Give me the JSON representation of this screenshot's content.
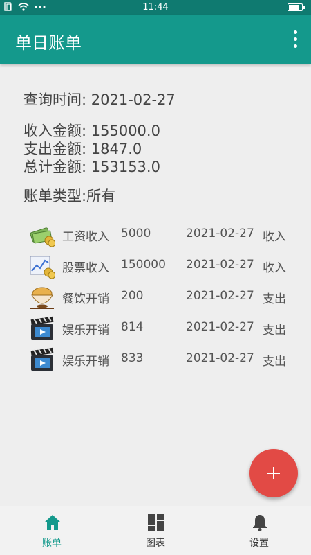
{
  "status_bar": {
    "time": "11:44"
  },
  "app_bar": {
    "title": "单日账单"
  },
  "summary": {
    "query_time": "查询时间: 2021-02-27",
    "income": "收入金额: 155000.0",
    "expense": "支出金额: 1847.0",
    "total": "总计金额: 153153.0",
    "bill_type": "账单类型:所有"
  },
  "bills": [
    {
      "name": "工资收入",
      "amount": "5000",
      "date": "2021-02-27",
      "type": "收入",
      "icon": "money-icon"
    },
    {
      "name": "股票收入",
      "amount": "150000",
      "date": "2021-02-27",
      "type": "收入",
      "icon": "stock-chart-icon"
    },
    {
      "name": "餐饮开销",
      "amount": "200",
      "date": "2021-02-27",
      "type": "支出",
      "icon": "food-bowl-icon"
    },
    {
      "name": "娱乐开销",
      "amount": "814",
      "date": "2021-02-27",
      "type": "支出",
      "icon": "clapperboard-icon"
    },
    {
      "name": "娱乐开销",
      "amount": "833",
      "date": "2021-02-27",
      "type": "支出",
      "icon": "clapperboard-icon"
    }
  ],
  "bottom_nav": [
    {
      "label": "账单",
      "icon": "home-icon",
      "active": true
    },
    {
      "label": "图表",
      "icon": "dashboard-icon",
      "active": false
    },
    {
      "label": "设置",
      "icon": "bell-icon",
      "active": false
    }
  ],
  "colors": {
    "primary": "#14998c",
    "status_bar": "#0f7a70",
    "fab": "#e24a45"
  }
}
